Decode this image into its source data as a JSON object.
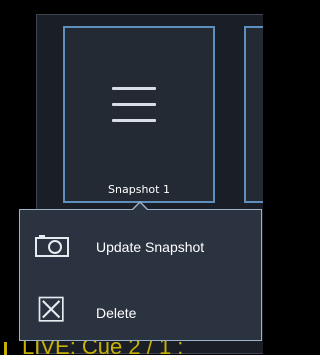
{
  "snapshot_tile": {
    "label": "Snapshot 1",
    "icon": "hamburger-menu-icon"
  },
  "context_menu": {
    "items": [
      {
        "label": "Update Snapshot",
        "icon": "camera-icon"
      },
      {
        "label": "Delete",
        "icon": "delete-box-icon"
      }
    ]
  },
  "status": {
    "text": "LIVE: Cue  2 / 1 :"
  },
  "colors": {
    "tile_border": "#5f8fbd",
    "popup_border": "#9cb2c8",
    "status_text": "#c8b000"
  }
}
